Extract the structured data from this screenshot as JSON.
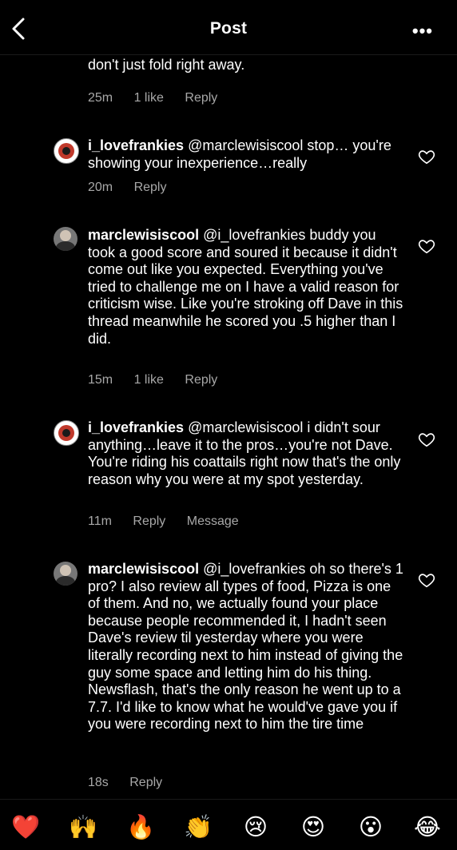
{
  "header": {
    "title": "Post",
    "more_label": "•••"
  },
  "partial_comment": {
    "text": "didn't look like it. Also, the fold is a last resort, you don't just fold right away.",
    "time": "25m",
    "likes": "1 like",
    "reply": "Reply"
  },
  "comments": [
    {
      "username": "i_lovefrankies",
      "text": " @marclewisiscool  stop… you're showing your inexperience…really",
      "time": "20m",
      "reply": "Reply"
    },
    {
      "username": "marclewisiscool",
      "text": " @i_lovefrankies buddy you took a good score and soured it because it didn't come out like you expected. Everything you've tried to challenge me on I have a valid reason for criticism wise. Like you're stroking off Dave in this thread meanwhile he scored you .5 higher than I did.",
      "time": "15m",
      "likes": "1 like",
      "reply": "Reply"
    },
    {
      "username": "i_lovefrankies",
      "text": " @marclewisiscool i didn't sour anything…leave it to the pros…you're not Dave. You're riding his coattails right now that's the only reason why you were at my spot yesterday.",
      "time": "11m",
      "reply": "Reply",
      "message": "Message"
    },
    {
      "username": "marclewisiscool",
      "text": " @i_lovefrankies oh so there's 1 pro? I also review all types of food, Pizza is one of them. And no, we actually found your place because people recommended it, I hadn't seen Dave's review til yesterday where you were literally recording next to him instead of giving the guy some space and letting him do his thing. Newsflash, that's the only reason he went up to a 7.7. I'd like to know what he would've gave you if you were recording next to him the tire time",
      "time": "18s",
      "reply": "Reply"
    }
  ],
  "reactions": [
    "❤️",
    "🙌",
    "🔥",
    "👏",
    "😢",
    "😍",
    "😮",
    "😂"
  ]
}
